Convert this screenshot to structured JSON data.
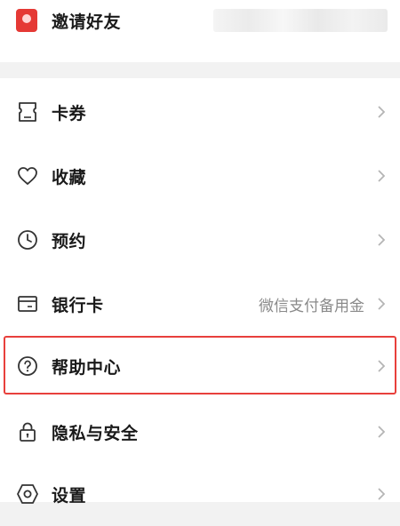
{
  "invite": {
    "label": "邀请好友"
  },
  "menu": {
    "items": [
      {
        "label": "卡券",
        "icon": "coupon-icon"
      },
      {
        "label": "收藏",
        "icon": "heart-icon"
      },
      {
        "label": "预约",
        "icon": "clock-icon"
      },
      {
        "label": "银行卡",
        "icon": "bank-card-icon",
        "sub": "微信支付备用金"
      },
      {
        "label": "帮助中心",
        "icon": "help-icon"
      },
      {
        "label": "隐私与安全",
        "icon": "lock-icon"
      },
      {
        "label": "设置",
        "icon": "settings-icon"
      }
    ]
  },
  "colors": {
    "accent": "#e53935",
    "highlight_border": "#e8403c",
    "chevron": "#b5b5b5"
  }
}
